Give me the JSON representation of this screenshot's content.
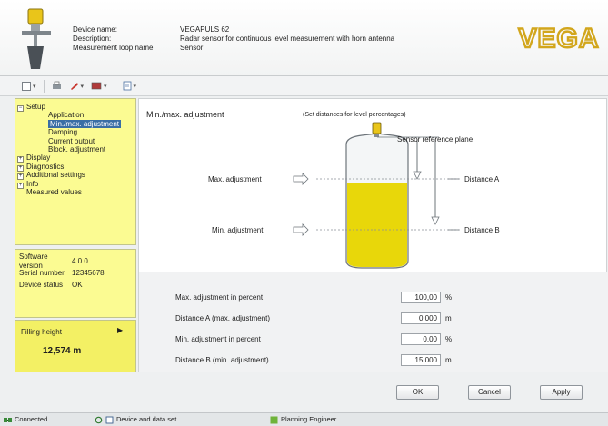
{
  "header": {
    "labels": {
      "device_name": "Device name:",
      "description": "Description:",
      "loop_name": "Measurement loop name:"
    },
    "values": {
      "device_name": "VEGAPULS 62",
      "description": "Radar sensor for continuous level measurement with horn antenna",
      "loop_name": "Sensor"
    },
    "logo_text": "VEGA",
    "logo_color": "#d2a61c"
  },
  "toolbar": {
    "icons": [
      "file-icon",
      "print-icon",
      "tool-icon",
      "device-icon",
      "report-icon"
    ]
  },
  "tree": {
    "items": [
      {
        "sign": "−",
        "label": "Setup"
      },
      {
        "label": "Application"
      },
      {
        "label": "Min./max. adjustment",
        "selected": true
      },
      {
        "label": "Damping"
      },
      {
        "label": "Current output"
      },
      {
        "label": "Block. adjustment"
      },
      {
        "sign": "+",
        "label": "Display"
      },
      {
        "sign": "+",
        "label": "Diagnostics"
      },
      {
        "sign": "+",
        "label": "Additional settings"
      },
      {
        "sign": "+",
        "label": "Info"
      },
      {
        "label": "Measured values"
      }
    ]
  },
  "status": {
    "software_label": "Software version",
    "software_value": "4.0.0",
    "serial_label": "Serial number",
    "serial_value": "12345678",
    "device_status_label": "Device status",
    "device_status_value": "OK"
  },
  "filling": {
    "label": "Filling height",
    "arrow": "▶",
    "value": "12,574 m"
  },
  "main": {
    "title": "Min./max. adjustment",
    "note": "(Set distances for level percentages)",
    "diagram": {
      "sensor_plane": "Sensor reference plane",
      "max_adj": "Max. adjustment",
      "min_adj": "Min. adjustment",
      "dist_a": "Distance A",
      "dist_b": "Distance B"
    },
    "fields": [
      {
        "label": "Max. adjustment in percent",
        "value": "100,00",
        "unit": "%"
      },
      {
        "label": "Distance A (max. adjustment)",
        "value": "0,000",
        "unit": "m"
      },
      {
        "label": "Min. adjustment in percent",
        "value": "0,00",
        "unit": "%"
      },
      {
        "label": "Distance B (min. adjustment)",
        "value": "15,000",
        "unit": "m"
      }
    ]
  },
  "buttons": {
    "ok": "OK",
    "cancel": "Cancel",
    "apply": "Apply"
  },
  "statusbar": {
    "connected": "Connected",
    "device_data": "Device and data set",
    "role": "Planning Engineer"
  },
  "colors": {
    "tree_bg": "#fbfb92",
    "fill_bg": "#f3f064",
    "tank_liquid": "#e8d70a",
    "selection": "#3a6ea5"
  }
}
